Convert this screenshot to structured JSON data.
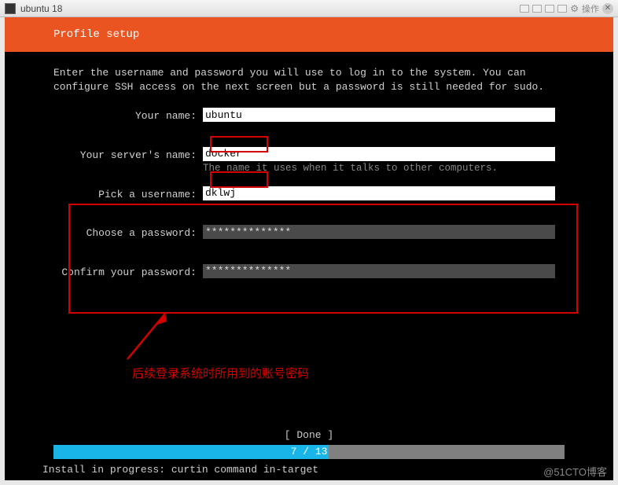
{
  "window": {
    "title": "ubuntu 18",
    "action_label": "操作"
  },
  "header": {
    "title": "Profile setup"
  },
  "intro": "Enter the username and password you will use to log in to the system. You can configure SSH access on the next screen but a password is still needed for sudo.",
  "form": {
    "name_label": "Your name:",
    "name_value": "ubuntu",
    "server_label": "Your server's name:",
    "server_value": "docker",
    "server_hint": "The name it uses when it talks to other computers.",
    "username_label": "Pick a username:",
    "username_value": "dklwj",
    "password_label": "Choose a password:",
    "password_value": "**************",
    "confirm_label": "Confirm your password:",
    "confirm_value": "**************"
  },
  "annotation": "后续登录系统时所用到的账号密码",
  "footer": {
    "done": "[ Done       ]",
    "progress_text": "7 / 13",
    "install_line": "Install in progress: curtin command in-target"
  },
  "watermark": "@51CTO博客"
}
